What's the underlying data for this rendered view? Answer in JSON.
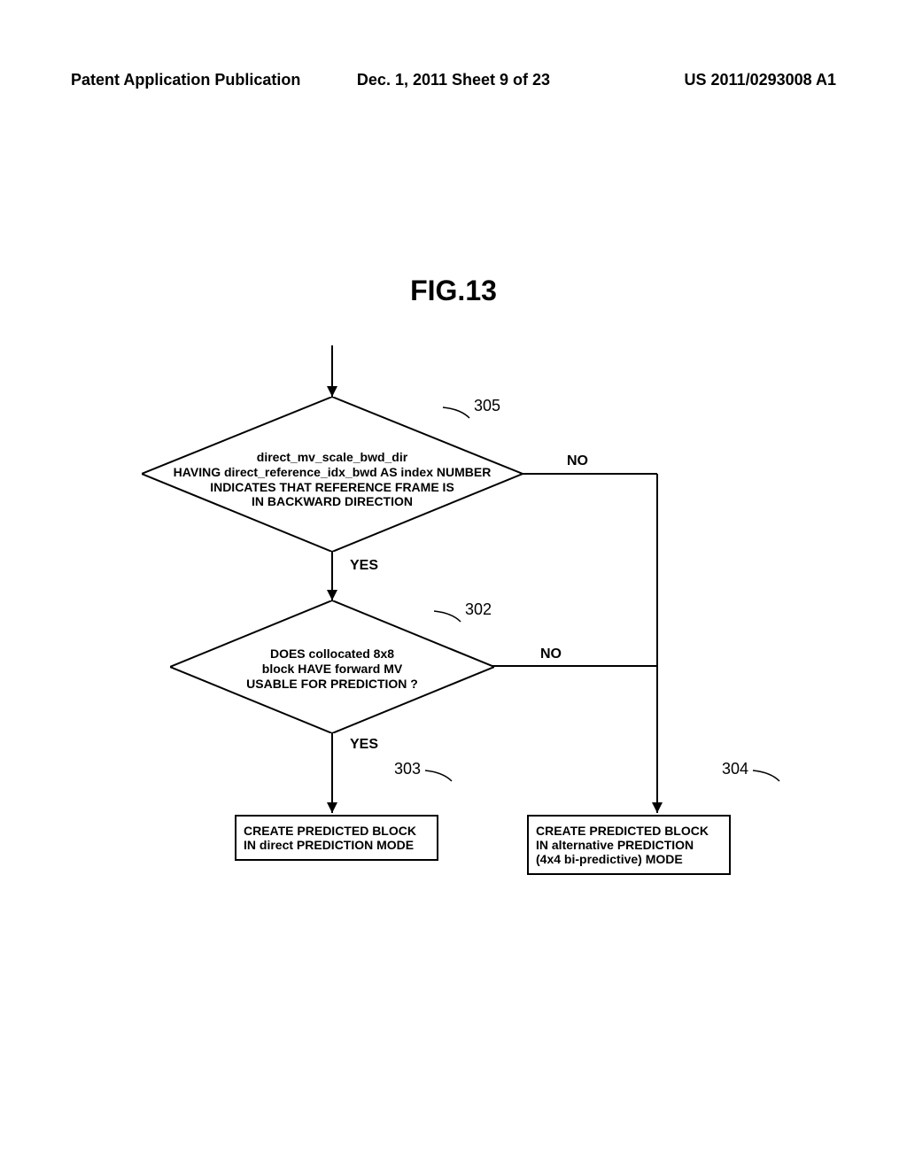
{
  "header": {
    "left": "Patent Application Publication",
    "center": "Dec. 1, 2011   Sheet 9 of 23",
    "right": "US 2011/0293008 A1"
  },
  "figure_title": "FIG.13",
  "decision1": {
    "ref": "305",
    "text_line1": "direct_mv_scale_bwd_dir",
    "text_line2": "HAVING direct_reference_idx_bwd AS index NUMBER",
    "text_line3": "INDICATES THAT REFERENCE FRAME IS",
    "text_line4": "IN BACKWARD DIRECTION"
  },
  "decision2": {
    "ref": "302",
    "text_line1": "DOES collocated 8x8",
    "text_line2": "block HAVE forward MV",
    "text_line3": "USABLE FOR PREDICTION ?"
  },
  "process1": {
    "ref": "303",
    "text_line1": "CREATE PREDICTED BLOCK",
    "text_line2": "IN direct PREDICTION MODE"
  },
  "process2": {
    "ref": "304",
    "text_line1": "CREATE PREDICTED BLOCK",
    "text_line2": "IN alternative PREDICTION",
    "text_line3": "(4x4 bi-predictive) MODE"
  },
  "labels": {
    "yes": "YES",
    "no": "NO"
  }
}
